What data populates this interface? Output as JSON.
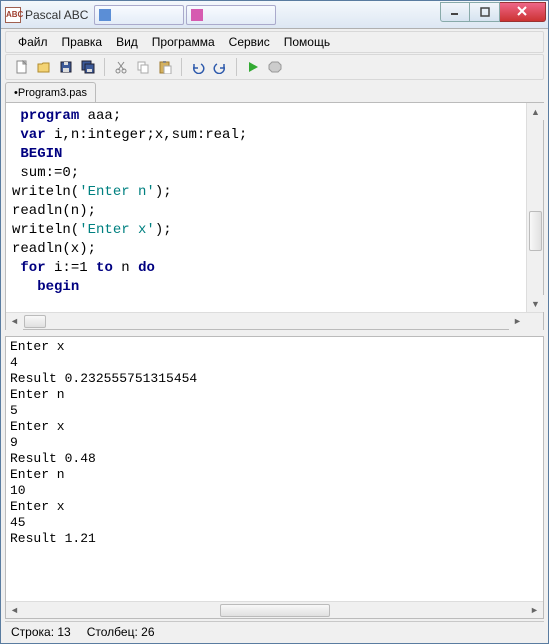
{
  "title": "Pascal ABC",
  "taskbar_tabs": [
    {
      "icon_color": "#5b8ed6",
      "label": ""
    },
    {
      "icon_color": "#d65bb0",
      "label": ""
    }
  ],
  "menu": [
    "Файл",
    "Правка",
    "Вид",
    "Программа",
    "Сервис",
    "Помощь"
  ],
  "toolbar_icons": {
    "new": "new-icon",
    "open": "open-icon",
    "save": "save-icon",
    "saveall": "saveall-icon",
    "cut": "cut-icon",
    "copy": "copy-icon",
    "paste": "paste-icon",
    "undo": "undo-icon",
    "redo": "redo-icon",
    "run": "run-icon",
    "stop": "stop-icon"
  },
  "filetab": {
    "modified": "•",
    "name": "Program3.pas"
  },
  "code_lines": [
    {
      "indent": 1,
      "tokens": [
        {
          "t": "program",
          "c": "kw"
        },
        {
          "t": " aaa;",
          "c": ""
        }
      ]
    },
    {
      "indent": 1,
      "tokens": [
        {
          "t": "var",
          "c": "kw"
        },
        {
          "t": " i,n:integer;x,sum:real;",
          "c": ""
        }
      ]
    },
    {
      "indent": 1,
      "tokens": [
        {
          "t": "BEGIN",
          "c": "kw"
        }
      ]
    },
    {
      "indent": 1,
      "tokens": [
        {
          "t": "sum:=0;",
          "c": ""
        }
      ]
    },
    {
      "indent": 0,
      "tokens": [
        {
          "t": "writeln(",
          "c": ""
        },
        {
          "t": "'Enter n'",
          "c": "str"
        },
        {
          "t": ");",
          "c": ""
        }
      ]
    },
    {
      "indent": 0,
      "tokens": [
        {
          "t": "readln(n);",
          "c": ""
        }
      ]
    },
    {
      "indent": 0,
      "tokens": [
        {
          "t": "writeln(",
          "c": ""
        },
        {
          "t": "'Enter x'",
          "c": "str"
        },
        {
          "t": ");",
          "c": ""
        }
      ]
    },
    {
      "indent": 0,
      "tokens": [
        {
          "t": "readln(x);",
          "c": ""
        }
      ]
    },
    {
      "indent": 1,
      "tokens": [
        {
          "t": "for",
          "c": "kw"
        },
        {
          "t": " i:=1 ",
          "c": ""
        },
        {
          "t": "to",
          "c": "kw"
        },
        {
          "t": " n ",
          "c": ""
        },
        {
          "t": "do",
          "c": "kw"
        }
      ]
    },
    {
      "indent": 3,
      "tokens": [
        {
          "t": "begin",
          "c": "kw"
        }
      ]
    }
  ],
  "output_lines": [
    "Enter x",
    "4",
    "Result 0.232555751315454",
    "Enter n",
    "5",
    "Enter x",
    "9",
    "Result 0.48",
    "Enter n",
    "10",
    "Enter x",
    "45",
    "Result 1.21"
  ],
  "status": {
    "row_label": "Строка:",
    "row": "13",
    "col_label": "Столбец:",
    "col": "26"
  }
}
